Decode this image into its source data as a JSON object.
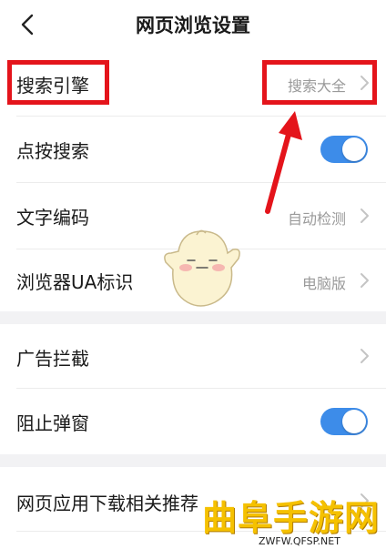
{
  "nav": {
    "title": "网页浏览设置",
    "back_icon": "chevron-left-icon"
  },
  "settings": [
    {
      "label": "搜索引擎",
      "value": "搜索大全",
      "control": "chevron"
    },
    {
      "label": "点按搜索",
      "control": "toggle",
      "enabled": true
    },
    {
      "label": "文字编码",
      "value": "自动检测",
      "control": "chevron"
    },
    {
      "label": "浏览器UA标识",
      "value": "电脑版",
      "control": "chevron"
    },
    {
      "label": "广告拦截",
      "control": "chevron"
    },
    {
      "label": "阻止弹窗",
      "control": "toggle",
      "enabled": true
    },
    {
      "label": "网页应用下载相关推荐",
      "control": "chevron"
    }
  ],
  "colors": {
    "toggle_on": "#3d8ce9",
    "highlight": "#e4141b",
    "section_gap": "#f2f2f4",
    "watermark": "#f5c100"
  },
  "watermark": {
    "brand": "曲阜手游网",
    "url": "ZWFW.QFSP.NET"
  }
}
